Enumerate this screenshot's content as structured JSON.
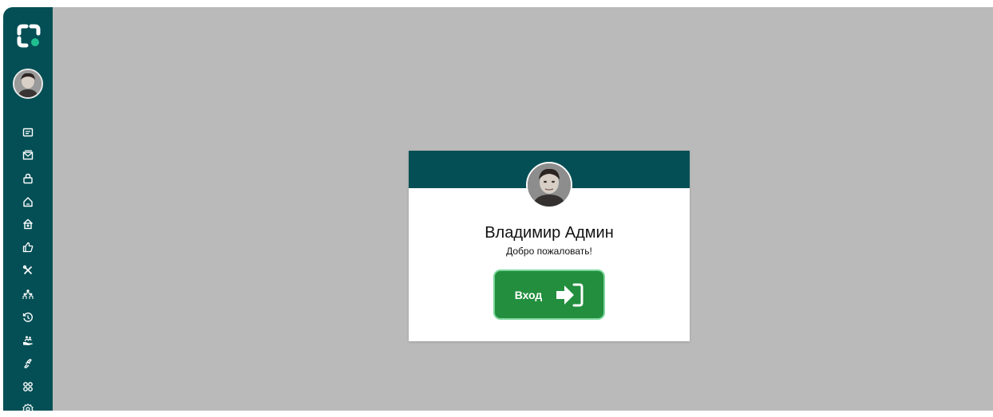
{
  "sidebar": {
    "items": [
      {
        "icon": "id-card-icon"
      },
      {
        "icon": "mail-send-icon"
      },
      {
        "icon": "bag-icon"
      },
      {
        "icon": "home-icon"
      },
      {
        "icon": "bank-home-icon"
      },
      {
        "icon": "thumbs-up-icon"
      },
      {
        "icon": "tools-icon"
      },
      {
        "icon": "team-icon"
      },
      {
        "icon": "history-icon"
      },
      {
        "icon": "hand-people-icon"
      },
      {
        "icon": "link-icon"
      },
      {
        "icon": "apps-grid-icon"
      },
      {
        "icon": "settings-icon"
      }
    ]
  },
  "card": {
    "user_name": "Владимир Админ",
    "welcome": "Добро пожаловать!",
    "login_label": "Вход"
  },
  "colors": {
    "sidebar": "#034f55",
    "main_bg": "#b9bab9",
    "button": "#228e3e",
    "logo_dot": "#1fbf8f"
  }
}
